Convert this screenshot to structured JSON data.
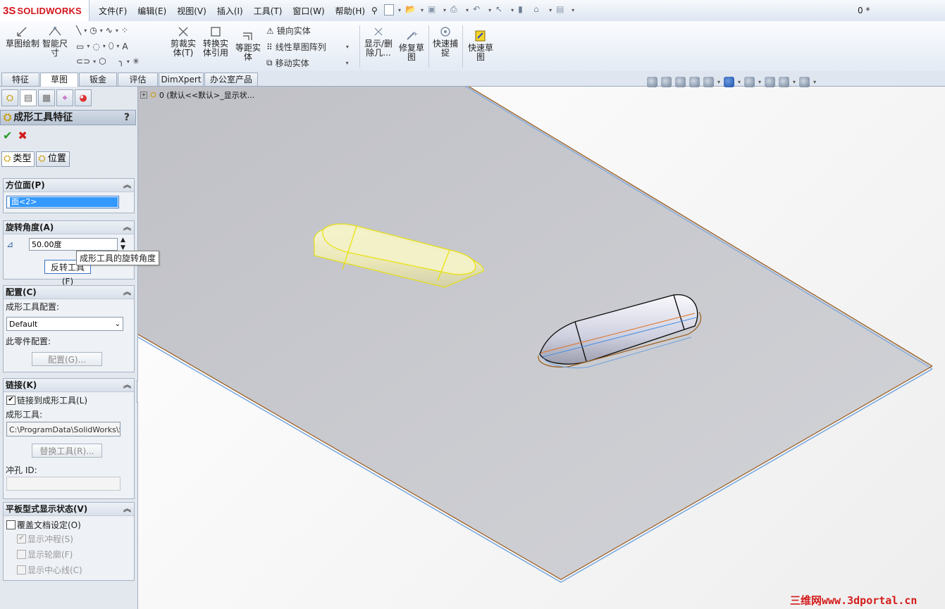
{
  "app": {
    "brand_mark": "3S",
    "brand_name": "SOLIDWORKS",
    "doc_title": "0 *"
  },
  "menu": [
    "文件(F)",
    "编辑(E)",
    "视图(V)",
    "插入(I)",
    "工具(T)",
    "窗口(W)",
    "帮助(H)"
  ],
  "ribbon": {
    "sketch_draw": "草图绘制",
    "smart_dim": "智能尺寸",
    "trim": "剪裁实体(T)",
    "convert": "转换实体引用",
    "offset": "等距实体",
    "mirror": "镜向实体",
    "linear_pattern": "线性草图阵列",
    "move": "移动实体",
    "show_delete": "显示/删除几...",
    "repair": "修复草图",
    "quick_snap": "快速捕捉",
    "quick_sketch": "快速草图"
  },
  "tabs": [
    "特征",
    "草图",
    "钣金",
    "评估",
    "DimXpert",
    "办公室产品"
  ],
  "active_tab": "草图",
  "panel": {
    "title": "成形工具特征",
    "help": "?",
    "ok_icon": "check-icon",
    "cancel_icon": "x-icon",
    "subtabs": [
      "类型",
      "位置"
    ],
    "face_group": {
      "title": "方位面(P)",
      "value": "面<2>"
    },
    "rotation_group": {
      "title": "旋转角度(A)",
      "value": "50.00度",
      "flip_button": "反转工具(F)"
    },
    "config_group": {
      "title": "配置(C)",
      "tool_config_label": "成形工具配置:",
      "tool_config_value": "Default",
      "part_config_label": "此零件配置:",
      "config_button": "配置(G)..."
    },
    "link_group": {
      "title": "链接(K)",
      "link_checkbox": "链接到成形工具(L)",
      "tool_label": "成形工具:",
      "tool_path": "C:\\ProgramData\\SolidWorks\\Soli",
      "replace_button": "替换工具(R)...",
      "punch_label": "冲孔 ID:",
      "punch_value": ""
    },
    "flat_group": {
      "title": "平板型式显示状态(V)",
      "override": "覆盖文档设定(O)",
      "show_punch": "显示冲程(S)",
      "show_profile": "显示轮廓(F)",
      "show_centerline": "显示中心线(C)"
    }
  },
  "tooltip": "成形工具的旋转角度",
  "tree_row": "0  (默认<<默认>_显示状...",
  "watermark": "三维网www.3dportal.cn"
}
